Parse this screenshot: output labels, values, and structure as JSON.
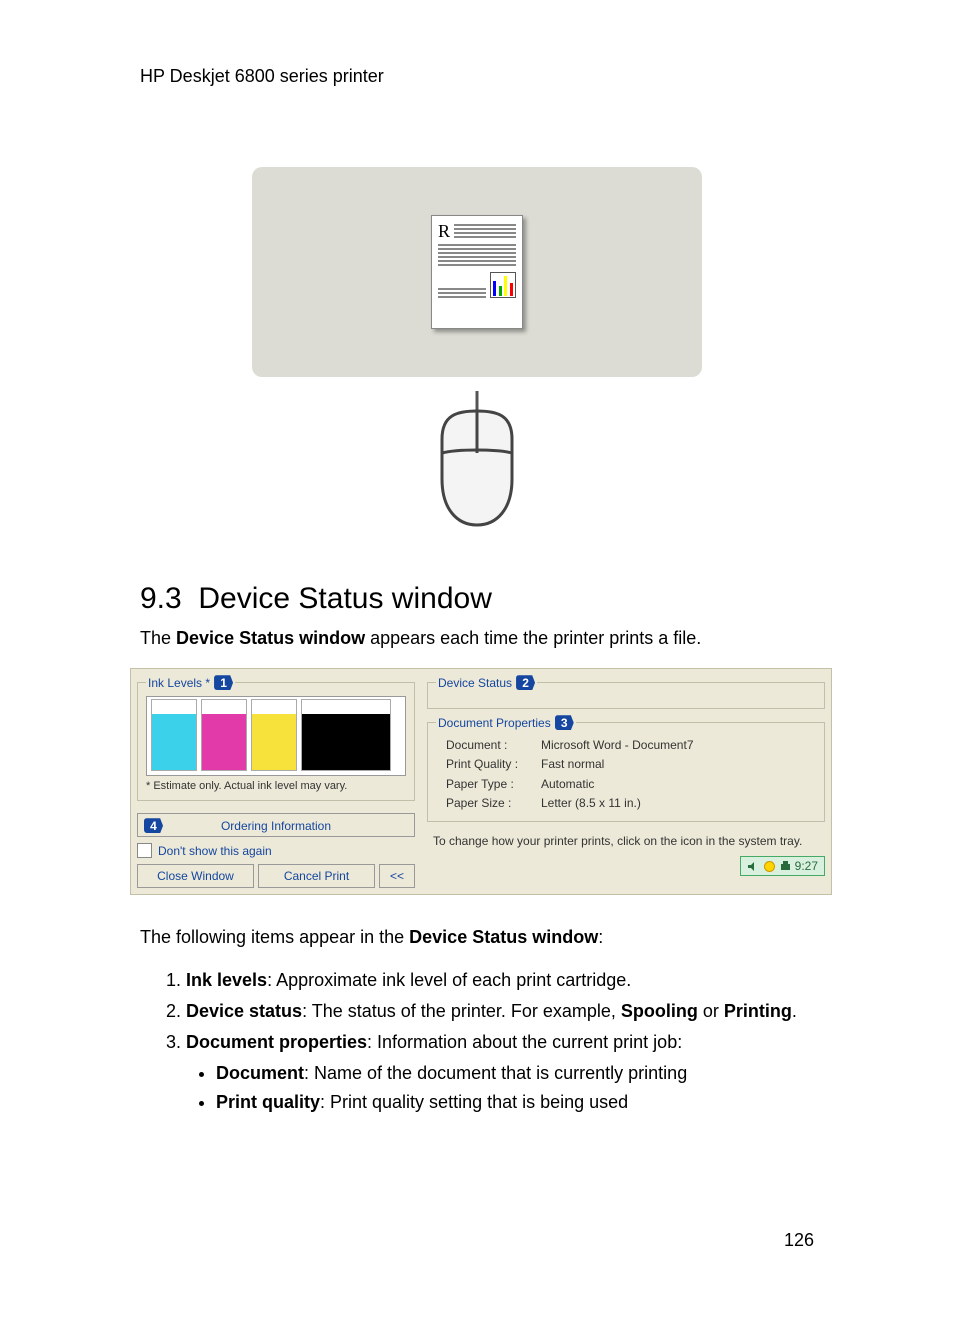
{
  "header": "HP Deskjet 6800 series printer",
  "doc_letter": "R",
  "section": {
    "num": "9.3",
    "title": "Device Status window"
  },
  "intro": {
    "pre": "The ",
    "bold": "Device Status window",
    "post": " appears each time the printer prints a file."
  },
  "status_window": {
    "ink": {
      "legend": "Ink Levels *",
      "callout": "1",
      "note": "* Estimate only.  Actual ink level may vary."
    },
    "order_btn": {
      "callout": "4",
      "label": "Ordering Information"
    },
    "dont_show": "Don't show this again",
    "buttons": {
      "close": "Close Window",
      "cancel": "Cancel Print",
      "collapse": "<<"
    },
    "device_status": {
      "legend": "Device Status",
      "callout": "2"
    },
    "doc_props": {
      "legend": "Document Properties",
      "callout": "3",
      "rows": [
        {
          "label": "Document :",
          "value": "Microsoft Word - Document7"
        },
        {
          "label": "Print Quality :",
          "value": "Fast normal"
        },
        {
          "label": "Paper Type :",
          "value": "Automatic"
        },
        {
          "label": "Paper Size :",
          "value": "Letter (8.5 x 11 in.)"
        }
      ]
    },
    "hint": "To change how your printer prints, click on the icon in the system tray.",
    "tray_time": "9:27"
  },
  "items_intro": {
    "pre": "The following items appear in the ",
    "bold": "Device Status window",
    "post": ":"
  },
  "items": [
    {
      "bold": "Ink levels",
      "text": ": Approximate ink level of each print cartridge."
    },
    {
      "bold": "Device status",
      "text_pre": ": The status of the printer. For example, ",
      "ex1": "Spooling",
      "mid": " or ",
      "ex2": "Printing",
      "post": "."
    },
    {
      "bold": "Document properties",
      "text": ": Information about the current print job:"
    }
  ],
  "sub_items": [
    {
      "bold": "Document",
      "text": ": Name of the document that is currently printing"
    },
    {
      "bold": "Print quality",
      "text": ": Print quality setting that is being used"
    }
  ],
  "page_num": "126"
}
